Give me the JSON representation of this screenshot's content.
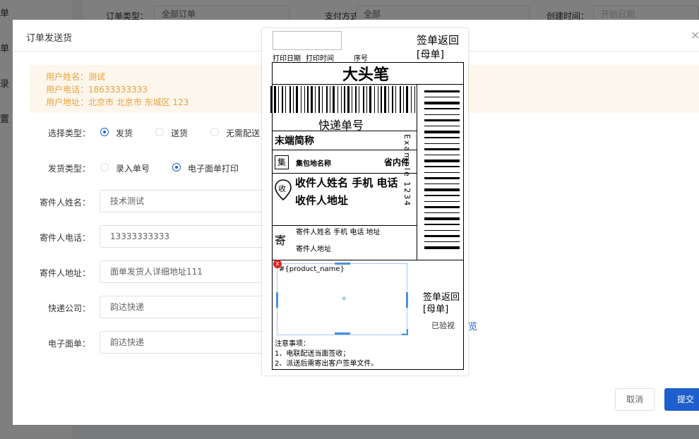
{
  "background": {
    "side_menu": [
      "单",
      "单",
      "录",
      "置"
    ],
    "filters": {
      "order_type_label": "订单类型：",
      "order_type_value": "全部订单",
      "pay_method_label": "支付方式：",
      "pay_method_value": "全部",
      "created_time_label": "创建时间：",
      "start_date_placeholder": "开始日期"
    }
  },
  "dialog": {
    "title": "订单发送货",
    "close_icon": "×",
    "notice": {
      "name": "用户姓名：测试",
      "phone": "用户电话：18633333333",
      "address": "用户地址：北京市 北京市 东城区 123"
    },
    "select_type": {
      "label": "选择类型：",
      "options": [
        "发货",
        "送货",
        "无需配送"
      ],
      "selected": "发货"
    },
    "ship_type": {
      "label": "发货类型：",
      "options": [
        "录入单号",
        "电子面单打印"
      ],
      "selected": "电子面单打印"
    },
    "fields": [
      {
        "label": "寄件人姓名：",
        "value": "技术测试"
      },
      {
        "label": "寄件人电话：",
        "value": "13333333333"
      },
      {
        "label": "寄件人地址：",
        "value": "面单发货人详细地址111"
      },
      {
        "label": "快递公司：",
        "value": "韵达快递"
      },
      {
        "label": "电子面单：",
        "value": "韵达快递"
      }
    ],
    "preview_link": "预览",
    "cancel_label": "取消",
    "submit_label": "提交"
  },
  "waybill": {
    "sign_return": "签单返回",
    "mother_slip": "[母单]",
    "print_date": "打印日期",
    "print_time": "打印时间",
    "serial": "序号",
    "big_pen": "大头笔",
    "tracking_label": "快递单号",
    "terminal_short": "末端简称",
    "collect_icon": "集",
    "collect_name": "集包地名称",
    "province_inside": "省内件",
    "receive_icon": "收",
    "receiver_line1": "收件人姓名 手机 电话",
    "receiver_line2": "收件人地址",
    "send_icon": "寄",
    "sender_line1": "寄件人姓名 手机 电话 地址",
    "sender_line2": "寄件人地址",
    "vertical_code": "Example 1234",
    "delete_badge": "x",
    "product_placeholder": "#{product_name}",
    "center_mark": "+",
    "sign_return_2": "签单返回",
    "mother_slip_2": "[母单]",
    "inspected": "已验视",
    "notes_title": "注意事项：",
    "note1": "1、电联配送当面签收；",
    "note2": "2、派送后需寄出客户签单文件。"
  },
  "colors": {
    "primary": "#1e5fcc",
    "warning_text": "#e6a23c",
    "notice_bg": "#fdf6ec",
    "selection_blue": "#4a90e2"
  }
}
